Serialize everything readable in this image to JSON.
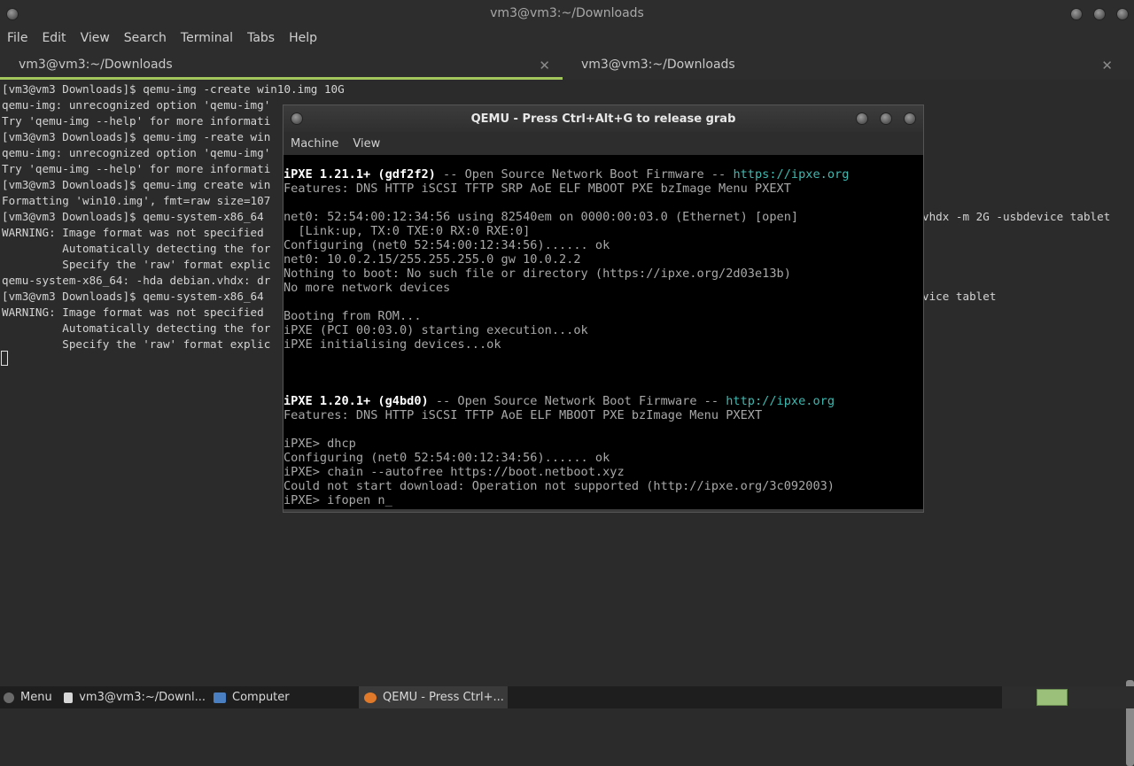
{
  "terminal": {
    "title": "vm3@vm3:~/Downloads",
    "menu": [
      "File",
      "Edit",
      "View",
      "Search",
      "Terminal",
      "Tabs",
      "Help"
    ],
    "tabs": [
      {
        "label": "vm3@vm3:~/Downloads",
        "close": "✕"
      },
      {
        "label": "vm3@vm3:~/Downloads",
        "close": "✕"
      }
    ],
    "lines": [
      "[vm3@vm3 Downloads]$ qemu-img -create win10.img 10G",
      "qemu-img: unrecognized option 'qemu-img'",
      "Try 'qemu-img --help' for more informati",
      "[vm3@vm3 Downloads]$ qemu-img -reate win",
      "qemu-img: unrecognized option 'qemu-img'",
      "Try 'qemu-img --help' for more informati",
      "[vm3@vm3 Downloads]$ qemu-img create win",
      "Formatting 'win10.img', fmt=raw size=107",
      "[vm3@vm3 Downloads]$ qemu-system-x86_64",
      "WARNING: Image format was not specified",
      "         Automatically detecting the for",
      "         Specify the 'raw' format explic",
      "qemu-system-x86_64: -hda debian.vhdx: dr",
      "[vm3@vm3 Downloads]$ qemu-system-x86_64",
      "WARNING: Image format was not specified",
      "         Automatically detecting the for",
      "         Specify the 'raw' format explic"
    ],
    "right_fragments": [
      {
        "text": "vhdx -m 2G -usbdevice tablet",
        "line": 8
      },
      {
        "text": "vice tablet",
        "line": 13
      }
    ]
  },
  "qemu": {
    "title": "QEMU - Press Ctrl+Alt+G to release grab",
    "menu": [
      "Machine",
      "View"
    ],
    "screen": [
      {
        "bold": "iPXE 1.21.1+ (gdf2f2)",
        "rest": " -- Open Source Network Boot Firmware -- ",
        "link": "https://ipxe.org"
      },
      {
        "text": "Features: DNS HTTP iSCSI TFTP SRP AoE ELF MBOOT PXE bzImage Menu PXEXT"
      },
      {
        "text": ""
      },
      {
        "text": "net0: 52:54:00:12:34:56 using 82540em on 0000:00:03.0 (Ethernet) [open]"
      },
      {
        "text": "  [Link:up, TX:0 TXE:0 RX:0 RXE:0]"
      },
      {
        "text": "Configuring (net0 52:54:00:12:34:56)...... ok"
      },
      {
        "text": "net0: 10.0.2.15/255.255.255.0 gw 10.0.2.2"
      },
      {
        "text": "Nothing to boot: No such file or directory (https://ipxe.org/2d03e13b)"
      },
      {
        "text": "No more network devices"
      },
      {
        "text": ""
      },
      {
        "text": "Booting from ROM..."
      },
      {
        "text": "iPXE (PCI 00:03.0) starting execution...ok"
      },
      {
        "text": "iPXE initialising devices...ok"
      },
      {
        "text": ""
      },
      {
        "text": ""
      },
      {
        "text": ""
      },
      {
        "bold": "iPXE 1.20.1+ (g4bd0)",
        "rest": " -- Open Source Network Boot Firmware -- ",
        "link": "http://ipxe.org"
      },
      {
        "text": "Features: DNS HTTP iSCSI TFTP AoE ELF MBOOT PXE bzImage Menu PXEXT"
      },
      {
        "text": ""
      },
      {
        "text": "iPXE> dhcp"
      },
      {
        "text": "Configuring (net0 52:54:00:12:34:56)...... ok"
      },
      {
        "text": "iPXE> chain --autofree https://boot.netboot.xyz"
      },
      {
        "text": "Could not start download: Operation not supported (http://ipxe.org/3c092003)"
      },
      {
        "text": "iPXE> ifopen n_"
      }
    ]
  },
  "taskbar": {
    "menu_label": "Menu",
    "items": [
      {
        "label": "vm3@vm3:~/Downl...",
        "icon": "terminal-icon"
      },
      {
        "label": "Computer",
        "icon": "computer-icon"
      },
      {
        "label": "QEMU - Press Ctrl+...",
        "icon": "qemu-icon"
      }
    ]
  },
  "colors": {
    "accent": "#a2c55c",
    "link": "#3fb8b0",
    "workspace": "#9bc07a"
  }
}
